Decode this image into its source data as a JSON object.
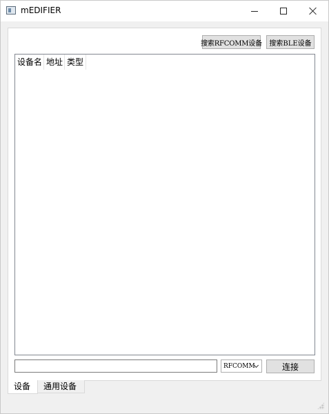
{
  "window": {
    "title": "mEDIFIER"
  },
  "toolbar": {
    "search_rfcomm_label": "搜索RFCOMM设备",
    "search_ble_label": "搜索BLE设备"
  },
  "device_list": {
    "columns": [
      "设备名",
      "地址",
      "类型"
    ],
    "rows": []
  },
  "footer": {
    "input_value": "",
    "protocol_selected": "RFCOMM",
    "connect_label": "连接"
  },
  "tabs": [
    {
      "label": "设备",
      "active": true
    },
    {
      "label": "通用设备",
      "active": false
    }
  ],
  "icons": {
    "app": "app-window-icon",
    "minimize": "minimize-icon",
    "maximize": "maximize-icon",
    "close": "close-icon",
    "dropdown": "chevron-down-icon",
    "grip": "resize-grip-icon"
  }
}
